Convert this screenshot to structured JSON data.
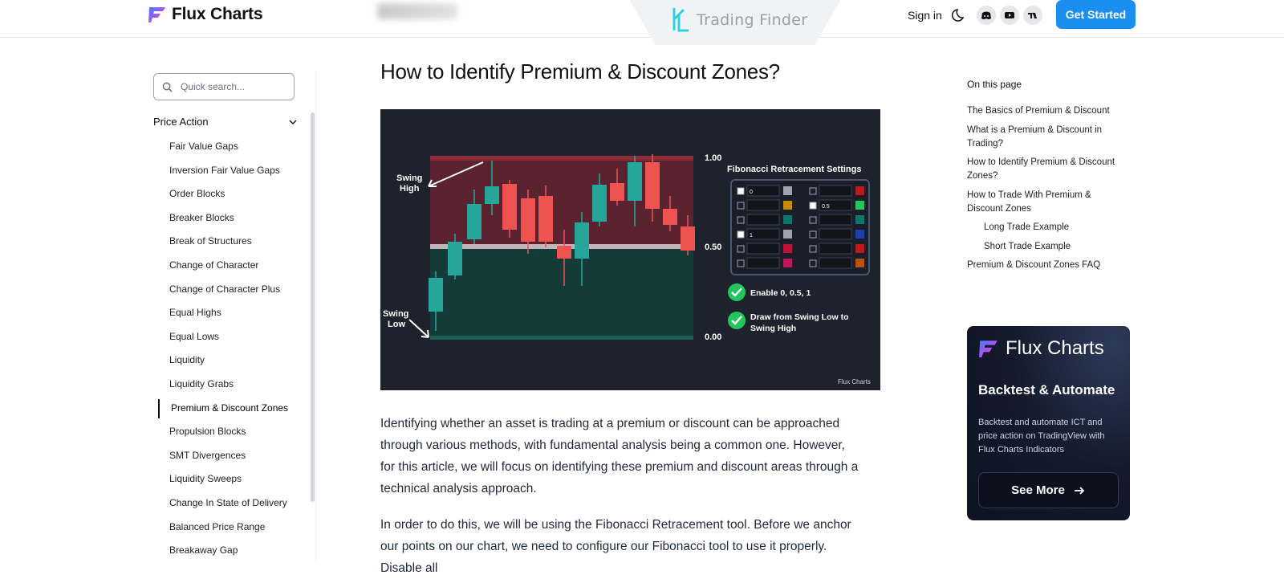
{
  "header": {
    "brand": "Flux Charts",
    "watermark": "Trading Finder",
    "sign_in": "Sign in",
    "get_started": "Get Started",
    "icons": [
      "moon-icon",
      "discord-icon",
      "youtube-icon",
      "tradingview-icon"
    ]
  },
  "sidebar": {
    "search_placeholder": "Quick search...",
    "section": "Price Action",
    "items": [
      "Fair Value Gaps",
      "Inversion Fair Value Gaps",
      "Order Blocks",
      "Breaker Blocks",
      "Break of Structures",
      "Change of Character",
      "Change of Character Plus",
      "Equal Highs",
      "Equal Lows",
      "Liquidity",
      "Liquidity Grabs",
      "Premium & Discount Zones",
      "Propulsion Blocks",
      "SMT Divergences",
      "Liquidity Sweeps",
      "Change In State of Delivery",
      "Balanced Price Range",
      "Breakaway Gap"
    ],
    "active_index": 11
  },
  "main": {
    "title": "How to Identify Premium & Discount Zones?",
    "paragraphs": [
      "Identifying whether an asset is trading at a premium or discount can be approached through various methods, with fundamental analysis being a common one. However, for this article, we will focus on identifying these premium and discount areas through a technical analysis approach.",
      "In order to do this, we will be using the Fibonacci Retracement tool. Before we anchor our points on our chart, we need to configure our Fibonacci tool to use it properly. Disable all"
    ]
  },
  "chart_image": {
    "swing_high": "Swing High",
    "swing_low": "Swing Low",
    "level_top": "1.00",
    "level_mid": "0.50",
    "level_bottom": "0.00",
    "settings_title": "Fibonacci Retracement Settings",
    "settings_left": [
      "0",
      "",
      "",
      "1",
      "",
      ""
    ],
    "settings_right": [
      "",
      "0.5",
      "",
      "",
      "",
      ""
    ],
    "check1": "Enable 0, 0.5, 1",
    "check2": "Draw from Swing Low to Swing High",
    "watermark": "Flux Charts",
    "colors": {
      "bg": "#1e222d",
      "bull": "#26a69a",
      "bear": "#ef5350",
      "premium": "#5b2330",
      "discount": "#153b38"
    }
  },
  "toc": {
    "title": "On this page",
    "items": [
      {
        "label": "The Basics of Premium & Discount",
        "sub": false
      },
      {
        "label": "What is a Premium & Discount in Trading?",
        "sub": false
      },
      {
        "label": "How to Identify Premium & Discount Zones?",
        "sub": false
      },
      {
        "label": "How to Trade With Premium & Discount Zones",
        "sub": false
      },
      {
        "label": "Long Trade Example",
        "sub": true
      },
      {
        "label": "Short Trade Example",
        "sub": true
      },
      {
        "label": "Premium & Discount Zones FAQ",
        "sub": false
      }
    ]
  },
  "promo": {
    "brand": "Flux Charts",
    "heading": "Backtest & Automate",
    "description": "Backtest and automate ICT and price action on TradingView with Flux Charts Indicators",
    "button": "See More"
  }
}
